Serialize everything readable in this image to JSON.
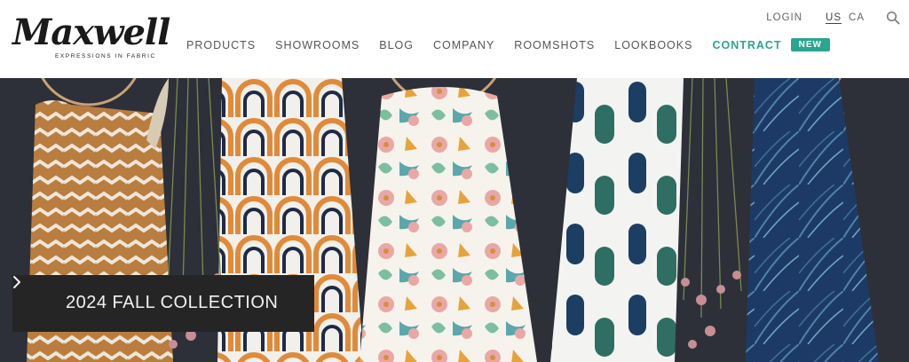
{
  "brand": {
    "name": "Maxwell",
    "tagline": "EXPRESSIONS IN FABRIC"
  },
  "nav": {
    "items": [
      {
        "label": "PRODUCTS"
      },
      {
        "label": "SHOWROOMS"
      },
      {
        "label": "BLOG"
      },
      {
        "label": "COMPANY"
      },
      {
        "label": "ROOMSHOTS"
      },
      {
        "label": "LOOKBOOKS"
      }
    ],
    "contract": {
      "label": "CONTRACT",
      "badge": "NEW"
    }
  },
  "utility": {
    "login": "LOGIN",
    "regions": [
      {
        "label": "US",
        "active": true
      },
      {
        "label": "CA",
        "active": false
      }
    ],
    "search_icon": "search-icon"
  },
  "hero": {
    "promo_label": "2024 FALL COLLECTION",
    "promo_arrow_icon": "chevron-right-icon"
  },
  "colors": {
    "accent": "#2aa58f",
    "hero_background": "#2d3038",
    "promo_background": "#252525"
  }
}
